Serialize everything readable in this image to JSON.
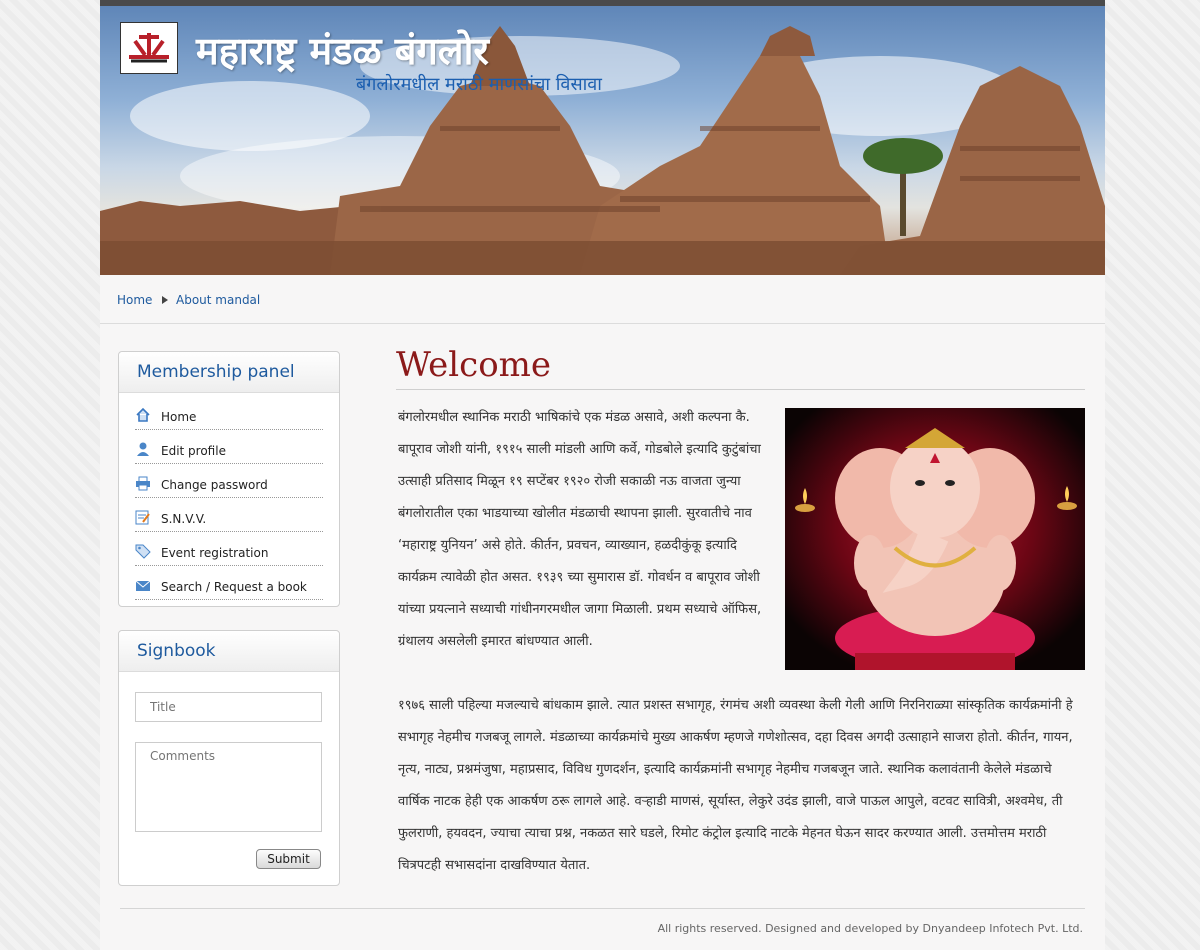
{
  "header": {
    "title": "महाराष्ट्र मंडळ बंगलोर",
    "subtitle": "बंगलोरमधील मराठी माणसांचा विसावा"
  },
  "breadcrumb": {
    "home": "Home",
    "current": "About mandal"
  },
  "membership_panel": {
    "title": "Membership panel",
    "items": [
      {
        "label": "Home",
        "icon": "home-icon"
      },
      {
        "label": "Edit profile",
        "icon": "user-icon"
      },
      {
        "label": "Change password",
        "icon": "printer-icon"
      },
      {
        "label": "S.N.V.V.",
        "icon": "edit-document-icon"
      },
      {
        "label": "Event registration",
        "icon": "tag-icon"
      },
      {
        "label": "Search / Request a book",
        "icon": "mail-icon"
      }
    ]
  },
  "signbook": {
    "title": "Signbook",
    "title_placeholder": "Title",
    "comments_placeholder": "Comments",
    "submit_label": "Submit"
  },
  "content": {
    "heading": "Welcome",
    "para1": "बंगलोरमधील स्थानिक मराठी भाषिकांचे एक मंडळ असावे, अशी कल्पना कै. बापूराव जोशी यांनी, १९१५ साली मांडली आणि कर्वे, गोडबोले इत्यादि कुटुंबांचा उत्साही प्रतिसाद मिळून १९ सप्टेंबर १९२० रोजी सकाळी नऊ वाजता जुन्या बंगलोरातील एका भाडयाच्या खोलीत मंडळाची स्थापना झाली. सुरवातीचे नाव ‘महाराष्ट्र युनियन’ असे होते. कीर्तन, प्रवचन, व्याख्यान, हळदीकुंकू इत्यादि कार्यक्रम त्यावेळी होत असत. १९३९ च्या सुमारास डॉ. गोवर्धन व बापूराव जोशी यांच्या प्रयत्नाने सध्याची गांधीनगरमधील जागा मिळाली. प्रथम सध्याचे ऑफिस, ग्रंथालय असलेली इमारत बांधण्यात आली.",
    "para2": "१९७६ साली पहिल्या मजल्याचे बांधकाम झाले. त्यात प्रशस्त सभागृह, रंगमंच अशी व्यवस्था केली गेली आणि निरनिराळ्या सांस्कृतिक कार्यक्रमांनी हे सभागृह नेहमीच गजबजू लागले. मंडळाच्या कार्यक्रमांचे मुख्य आकर्षण म्हणजे गणेशोत्सव, दहा दिवस अगदी उत्साहाने साजरा होतो. कीर्तन, गायन, नृत्य, नाट्य, प्रश्नमंजुषा, महाप्रसाद, विविध गुणदर्शन, इत्यादि कार्यक्रमांनी सभागृह नेहमीच गजबजून जाते. स्थानिक कलावंतानी केलेले मंडळाचे वार्षिक नाटक हेही एक आकर्षण ठरू लागले आहे. वऱ्हाडी माणसं, सूर्यास्त, लेकुरे उदंड झाली, वाजे पाऊल आपुले, वटवट सावित्री, अश्वमेध, ती फुलराणी, हयवदन, ज्याचा त्याचा प्रश्न, नकळत सारे घडले, रिमोट कंट्रोल इत्यादि नाटके मेहनत घेऊन सादर करण्यात आली. उत्तमोत्तम मराठी चित्रपटही सभासदांना दाखविण्यात येतात."
  },
  "footer": {
    "text": "All rights reserved. Designed and developed by Dnyandeep Infotech Pvt. Ltd."
  },
  "colors": {
    "link": "#1e5a9e",
    "welcome": "#8b1a1a",
    "topbar": "#4a4a4a"
  }
}
